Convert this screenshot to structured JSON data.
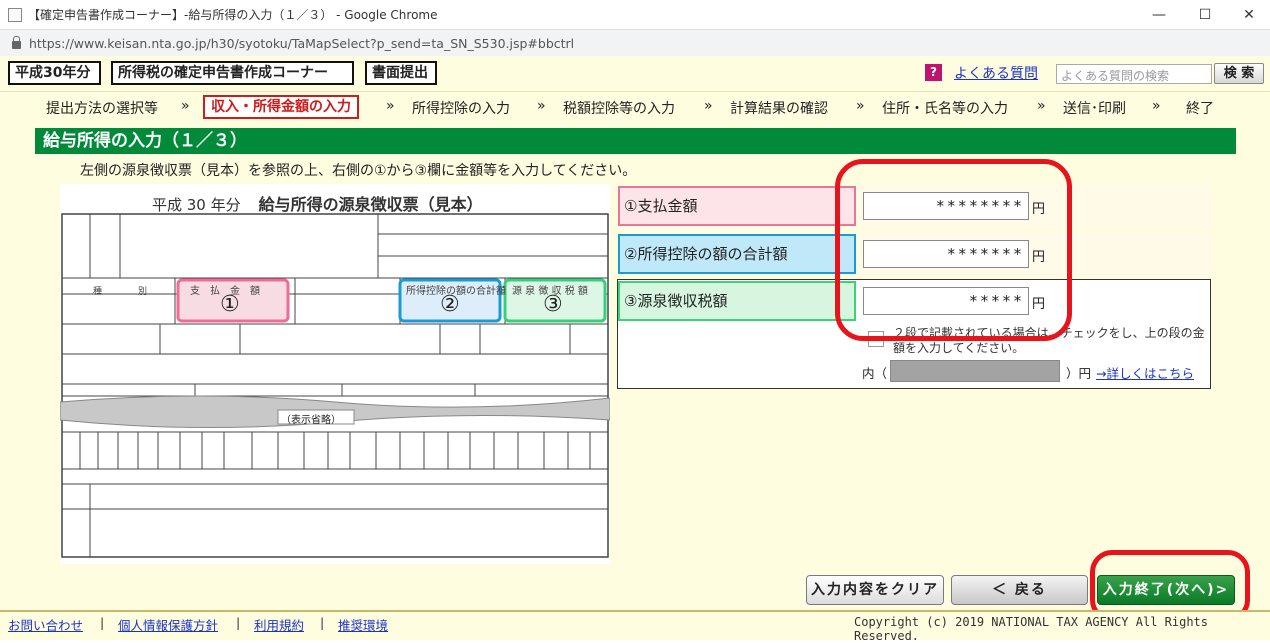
{
  "window": {
    "title": "【確定申告書作成コーナー】-給与所得の入力（１／３） - Google Chrome",
    "url": "https://www.keisan.nta.go.jp/h30/syotoku/TaMapSelect?p_send=ta_SN_S530.jsp#bbctrl",
    "min_icon": "minimize-icon",
    "max_icon": "maximize-icon",
    "close_icon": "close-icon"
  },
  "header": {
    "year": "平成30年分",
    "corner": "所得税の確定申告書作成コーナー",
    "submit": "書面提出",
    "faq_icon": "?",
    "faq_link": "よくある質問",
    "faq_search_placeholder": "よくある質問の検索",
    "faq_search_btn": "検 索"
  },
  "steps": [
    {
      "label": "提出方法の選択等"
    },
    {
      "label": "収入・所得金額の入力",
      "active": true
    },
    {
      "label": "所得控除の入力"
    },
    {
      "label": "税額控除等の入力"
    },
    {
      "label": "計算結果の確認"
    },
    {
      "label": "住所・氏名等の入力"
    },
    {
      "label": "送信･印刷"
    },
    {
      "label": "終了"
    }
  ],
  "step_arrow": "»",
  "section_title": "給与所得の入力（１／３）",
  "instruction": "左側の源泉徴収票（見本）を参照の上、右側の①から③欄に金額等を入力してください。",
  "slip": {
    "year_label": "平成 30 年分",
    "title": "給与所得の源泉徴収票（見本）",
    "marker1": "①",
    "marker2": "②",
    "marker3": "③",
    "col1": "支　払　金　額",
    "col2": "所得控除の額の合計額",
    "col3": "源 泉 徴 収 税 額",
    "omit": "（表示省略）",
    "shubetsu": "種　　　　別"
  },
  "fields": [
    {
      "num": "①",
      "label": "支払金額",
      "value": "********",
      "unit": "円",
      "color": "#e8759a",
      "bg": "#fce4e8"
    },
    {
      "num": "②",
      "label": "所得控除の額の合計額",
      "value": "*******",
      "unit": "円",
      "color": "#1b9ad6",
      "bg": "#bfe8f8"
    },
    {
      "num": "③",
      "label": "源泉徴収税額",
      "value": "*****",
      "unit": "円",
      "color": "#3cd27a",
      "bg": "#d6f6df"
    }
  ],
  "two_row_check": "２段で記載されている場合は、チェックをし、上の段の金額を入力してください。",
  "uchi": {
    "prefix": "内（",
    "suffix": "）円",
    "detail_link": "→詳しくはこちら"
  },
  "buttons": {
    "clear": "入力内容をクリア",
    "back": "＜ 戻る",
    "next": "入力終了(次へ)>"
  },
  "footer": {
    "links": [
      "お問い合わせ",
      "個人情報保護方針",
      "利用規約",
      "推奨環境"
    ],
    "separator": "|",
    "copyright": "Copyright (c) 2019 NATIONAL TAX AGENCY All Rights Reserved."
  }
}
